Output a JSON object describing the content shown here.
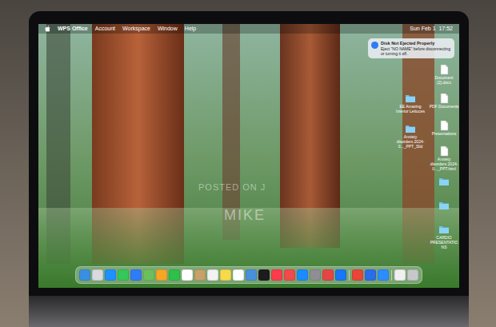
{
  "menubar": {
    "app": "WPS Office",
    "items": [
      "Account",
      "Workspace",
      "Window",
      "Help"
    ],
    "clock": "Sun Feb 1  17:52"
  },
  "notification": {
    "title": "Disk Not Ejected Properly",
    "body": "Eject \"NO NAME\" before disconnecting or turning it off."
  },
  "desktop_icons": [
    {
      "label": "Document (2).docx",
      "kind": "document"
    },
    {
      "label": "EE Amazing Interior Lettuces",
      "kind": "folder"
    },
    {
      "label": "PDF Documents",
      "kind": "document"
    },
    {
      "label": "Anxiety disorders 2024-0..._PPT_Slid",
      "kind": "folder"
    },
    {
      "label": "Presentations",
      "kind": "document"
    },
    {
      "label": "Anxiety disorders 2024-0..._PPT.html",
      "kind": "document"
    },
    {
      "kind": "folder"
    },
    {
      "kind": "folder"
    },
    {
      "label": "CARDIO PRESENTATIONS",
      "kind": "folder"
    }
  ],
  "watermark": [
    "POSTED ON J",
    "MIKE"
  ],
  "dock": [
    {
      "color": "#3b8fe0"
    },
    {
      "color": "#d9d9e0"
    },
    {
      "color": "#1e90ff"
    },
    {
      "color": "#34c759"
    },
    {
      "color": "#2f7cf6"
    },
    {
      "color": "#6cc05a"
    },
    {
      "color": "#f5a623"
    },
    {
      "color": "#2fbf4a"
    },
    {
      "color": "#ffffff"
    },
    {
      "color": "#c8a06a"
    },
    {
      "color": "#f2f2f2"
    },
    {
      "color": "#f7d94c"
    },
    {
      "color": "#ffffff"
    },
    {
      "color": "#4a90d9"
    },
    {
      "color": "#1c1c1e"
    },
    {
      "color": "#fa3c4c"
    },
    {
      "color": "#f04a4a"
    },
    {
      "color": "#1a8cff"
    },
    {
      "color": "#8e8e93"
    },
    {
      "color": "#e64545"
    },
    {
      "color": "#1877f2"
    },
    {
      "color": "#e8463a"
    },
    {
      "color": "#2b6de8"
    },
    {
      "color": "#2d8cff"
    },
    {
      "color": "#f0f0f0"
    },
    {
      "color": "#c7c7cc"
    }
  ]
}
